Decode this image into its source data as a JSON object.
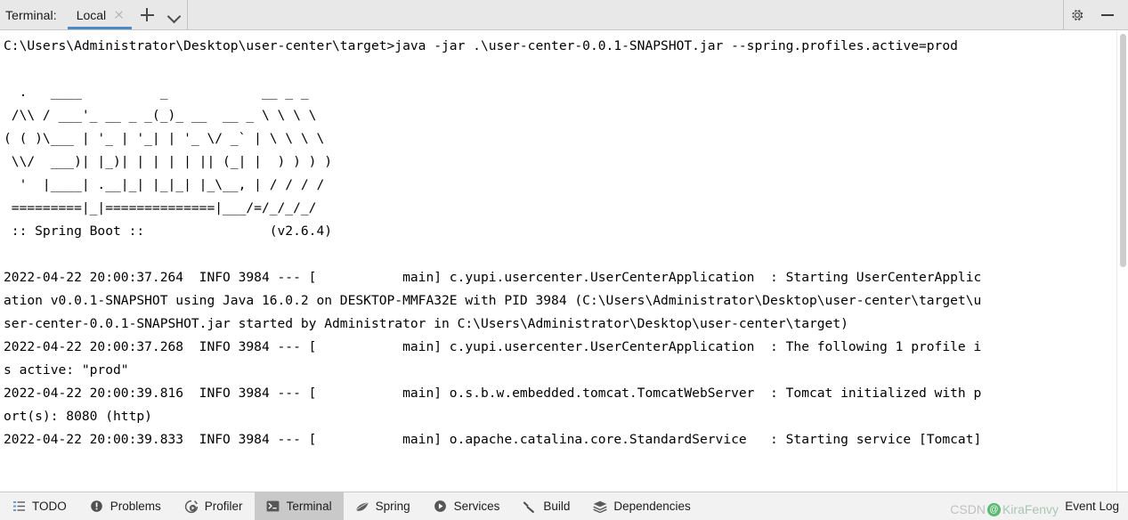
{
  "header": {
    "title": "Terminal:",
    "tabs": [
      {
        "label": "Local",
        "active": true
      }
    ],
    "add_tab_label": "+",
    "dropdown_label": "⌄",
    "settings_icon": "gear-icon",
    "minimize_icon": "minimize-icon",
    "close_tab_icon": "close-icon"
  },
  "terminal": {
    "lines": [
      "C:\\Users\\Administrator\\Desktop\\user-center\\target>java -jar .\\user-center-0.0.1-SNAPSHOT.jar --spring.profiles.active=prod",
      "",
      "  .   ____          _            __ _ _",
      " /\\\\ / ___'_ __ _ _(_)_ __  __ _ \\ \\ \\ \\",
      "( ( )\\___ | '_ | '_| | '_ \\/ _` | \\ \\ \\ \\",
      " \\\\/  ___)| |_)| | | | | || (_| |  ) ) ) )",
      "  '  |____| .__|_| |_|_| |_\\__, | / / / /",
      " =========|_|==============|___/=/_/_/_/",
      " :: Spring Boot ::                (v2.6.4)",
      "",
      "2022-04-22 20:00:37.264  INFO 3984 --- [           main] c.yupi.usercenter.UserCenterApplication  : Starting UserCenterApplic",
      "ation v0.0.1-SNAPSHOT using Java 16.0.2 on DESKTOP-MMFA32E with PID 3984 (C:\\Users\\Administrator\\Desktop\\user-center\\target\\u",
      "ser-center-0.0.1-SNAPSHOT.jar started by Administrator in C:\\Users\\Administrator\\Desktop\\user-center\\target)",
      "2022-04-22 20:00:37.268  INFO 3984 --- [           main] c.yupi.usercenter.UserCenterApplication  : The following 1 profile i",
      "s active: \"prod\"",
      "2022-04-22 20:00:39.816  INFO 3984 --- [           main] o.s.b.w.embedded.tomcat.TomcatWebServer  : Tomcat initialized with p",
      "ort(s): 8080 (http)",
      "2022-04-22 20:00:39.833  INFO 3984 --- [           main] o.apache.catalina.core.StandardService   : Starting service [Tomcat]"
    ],
    "spring_boot_version": "(v2.6.4)",
    "pid": "3984",
    "port": "8080",
    "active_profile": "prod",
    "java_version": "16.0.2",
    "hostname": "DESKTOP-MMFA32E",
    "app_version": "v0.0.1-SNAPSHOT",
    "log_date": "2022-04-22"
  },
  "status_bar": {
    "items": [
      {
        "label": "TODO",
        "icon": "todo-icon",
        "selected": false
      },
      {
        "label": "Problems",
        "icon": "problems-icon",
        "selected": false
      },
      {
        "label": "Profiler",
        "icon": "profiler-icon",
        "selected": false
      },
      {
        "label": "Terminal",
        "icon": "terminal-icon",
        "selected": true
      },
      {
        "label": "Spring",
        "icon": "spring-leaf-icon",
        "selected": false
      },
      {
        "label": "Services",
        "icon": "services-icon",
        "selected": false
      },
      {
        "label": "Build",
        "icon": "build-hammer-icon",
        "selected": false
      },
      {
        "label": "Dependencies",
        "icon": "dependencies-icon",
        "selected": false
      }
    ],
    "event_log_label": "Event Log"
  },
  "watermark": {
    "prefix": "CSDN",
    "badge": "@",
    "name": "KiraFenvy"
  },
  "colors": {
    "accent": "#4a88c7",
    "header_bg": "#e8e8e8",
    "status_bg": "#f2f2f2",
    "selected_tab_bg": "#c9c9c9",
    "terminal_bg": "#ffffff",
    "terminal_fg": "#000000"
  }
}
